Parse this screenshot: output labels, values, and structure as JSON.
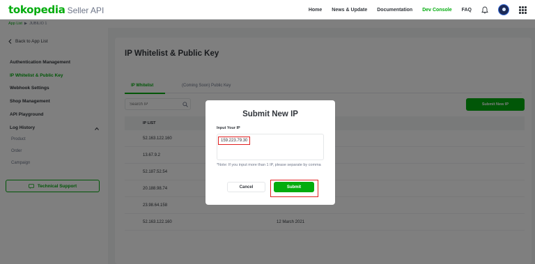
{
  "header": {
    "logo_brand": "tokopedia",
    "logo_sub": "Seller API",
    "nav": [
      "Home",
      "News & Update",
      "Documentation",
      "Dev Console",
      "FAQ"
    ],
    "active_nav": "Dev Console",
    "accent_color": "#03ac0e"
  },
  "breadcrumb": {
    "link": "App List",
    "separator": "▶",
    "current": "JUBILIO 1"
  },
  "sidebar": {
    "back_label": "Back to App List",
    "items": [
      "Authentication Management",
      "IP Whitelist & Public Key",
      "Webhook Settings",
      "Shop Management",
      "API Playground",
      "Log History"
    ],
    "active_item": "IP Whitelist & Public Key",
    "log_history_sub": [
      "Product",
      "Order",
      "Campaign"
    ],
    "support_label": "Technical Support"
  },
  "main": {
    "title": "IP Whitelist & Public Key",
    "tabs": [
      "IP Whitelist",
      "(Coming Soon) Public Key"
    ],
    "search_placeholder": "Search IP",
    "submit_new_label": "Submit New IP",
    "table": {
      "header": "IP LIST",
      "rows": [
        {
          "ip": "52.163.122.160",
          "date": ""
        },
        {
          "ip": "13.67.9.2",
          "date": ""
        },
        {
          "ip": "52.187.52.54",
          "date": ""
        },
        {
          "ip": "20.188.98.74",
          "date": ""
        },
        {
          "ip": "23.98.64.158",
          "date": ""
        },
        {
          "ip": "52.163.122.160",
          "date": "12 March 2021"
        }
      ]
    }
  },
  "modal": {
    "title": "Submit New IP",
    "input_label": "Input Your IP",
    "ip_value": "159.223.79.30",
    "note": "*Note: If you input more than 1 IP, please separate by comma",
    "cancel_label": "Cancel",
    "submit_label": "Submit"
  }
}
